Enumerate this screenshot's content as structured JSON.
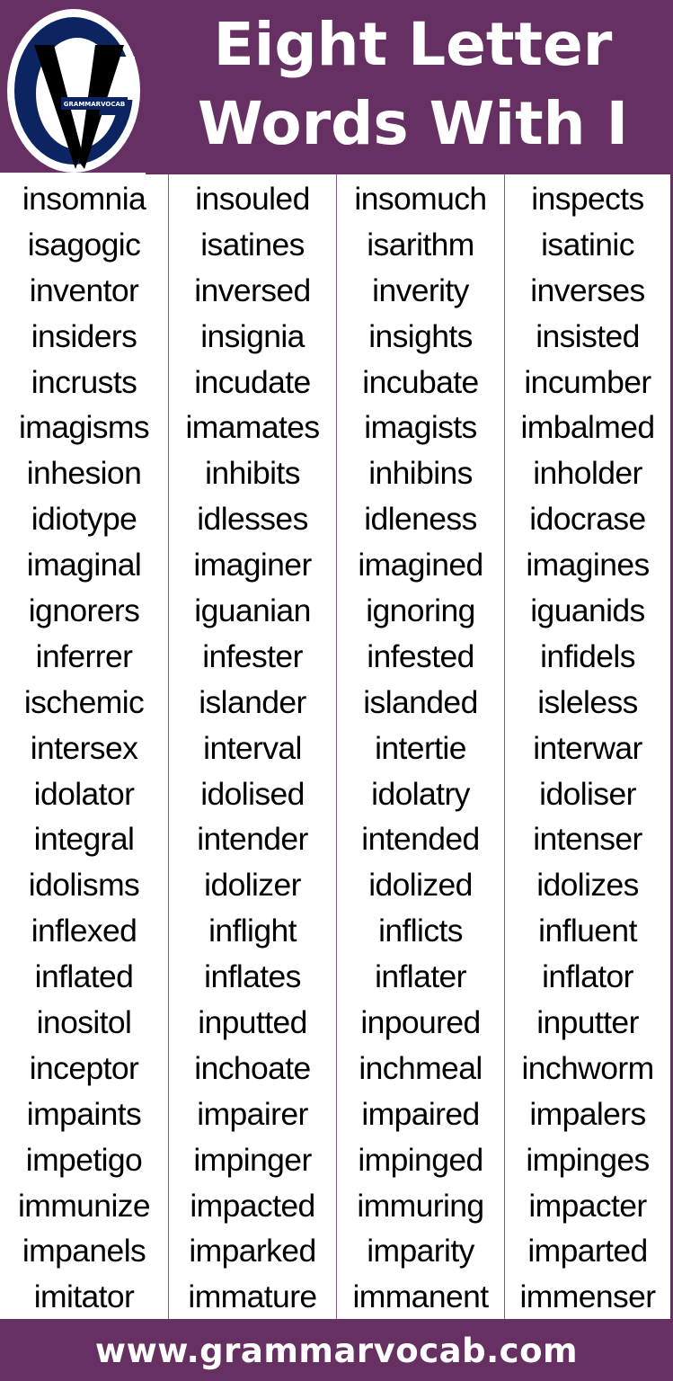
{
  "header": {
    "title_line1": "Eight Letter",
    "title_line2": "Words With I",
    "logo": {
      "icon": "grammarvocab-logo-icon",
      "text": "GRAMMARVOCAB",
      "colors": {
        "ring": "#0c2461",
        "v": "#000000",
        "bg": "#ffffff"
      }
    }
  },
  "colors": {
    "brand": "#663162",
    "text": "#000000",
    "background": "#ffffff"
  },
  "words": {
    "columns": [
      [
        "insomnia",
        "isagogic",
        "inventor",
        "insiders",
        "incrusts",
        "imagisms",
        "inhesion",
        "idiotype",
        "imaginal",
        "ignorers",
        "inferrer",
        "ischemic",
        "intersex",
        "idolator",
        "integral",
        "idolisms",
        "inflexed",
        "inflated",
        "inositol",
        "inceptor",
        "impaints",
        "impetigo",
        "immunize",
        "impanels",
        "imitator"
      ],
      [
        "insouled",
        "isatines",
        "inversed",
        "insignia",
        "incudate",
        "imamates",
        "inhibits",
        "idlesses",
        "imaginer",
        "iguanian",
        "infester",
        "islander",
        "interval",
        "idolised",
        "intender",
        "idolizer",
        "inflight",
        "inflates",
        "inputted",
        "inchoate",
        "impairer",
        "impinger",
        "impacted",
        "imparked",
        "immature"
      ],
      [
        "insomuch",
        "isarithm",
        "inverity",
        "insights",
        "incubate",
        "imagists",
        "inhibins",
        "idleness",
        "imagined",
        "ignoring",
        "infested",
        "islanded",
        "intertie",
        "idolatry",
        "intended",
        "idolized",
        "inflicts",
        "inflater",
        "inpoured",
        "inchmeal",
        "impaired",
        "impinged",
        "immuring",
        "imparity",
        "immanent"
      ],
      [
        "inspects",
        "isatinic",
        "inverses",
        "insisted",
        "incumber",
        "imbalmed",
        "inholder",
        "idocrase",
        "imagines",
        "iguanids",
        "infidels",
        "isleless",
        "interwar",
        "idoliser",
        "intenser",
        "idolizes",
        "influent",
        "inflator",
        "inputter",
        "inchworm",
        "impalers",
        "impinges",
        "impacter",
        "imparted",
        "immenser"
      ]
    ]
  },
  "footer": {
    "url": "www.grammarvocab.com"
  }
}
